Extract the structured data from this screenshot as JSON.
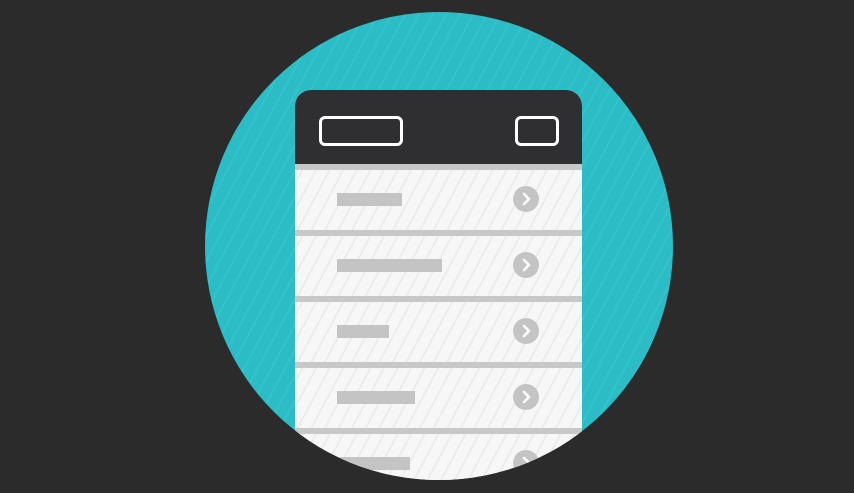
{
  "illustration": {
    "subject": "mobile-list-screen",
    "colors": {
      "background": "#2b2b2b",
      "circle": "#2bbcc5",
      "header": "#2f2e30",
      "list": "#f3f3f3",
      "placeholder": "#c4c4c4"
    },
    "header": {
      "left_icon": "rounded-rect-outline",
      "right_icon": "rounded-rect-outline"
    },
    "rows": [
      {
        "bar_fill": 0.44,
        "icon": "chevron-right-icon"
      },
      {
        "bar_fill": 0.71,
        "icon": "chevron-right-icon"
      },
      {
        "bar_fill": 0.35,
        "icon": "chevron-right-icon"
      },
      {
        "bar_fill": 0.53,
        "icon": "chevron-right-icon"
      },
      {
        "bar_fill": 0.49,
        "icon": "chevron-right-icon"
      }
    ]
  }
}
